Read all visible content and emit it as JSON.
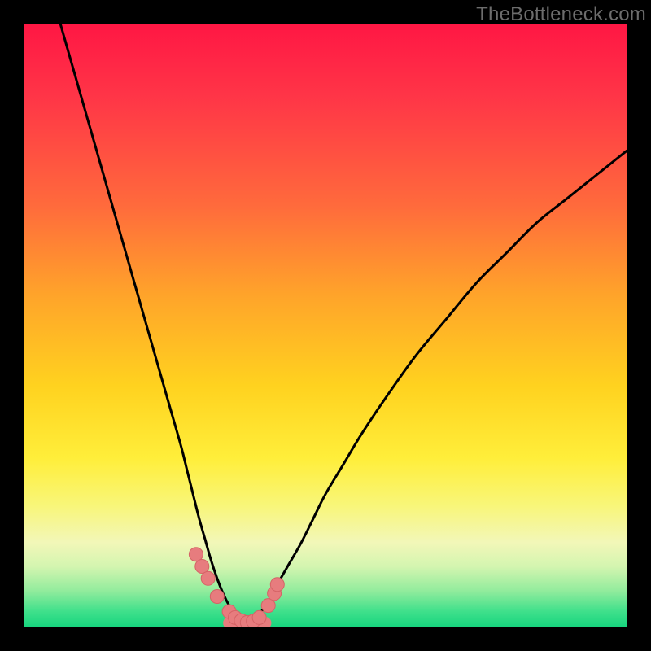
{
  "watermark": "TheBottleneck.com",
  "colors": {
    "black": "#000000",
    "curve": "#000000",
    "marker_fill": "#e77c7e",
    "marker_stroke": "#d56366",
    "gradient_stops": [
      {
        "offset": 0.0,
        "color": "#ff1744"
      },
      {
        "offset": 0.12,
        "color": "#ff3547"
      },
      {
        "offset": 0.3,
        "color": "#ff6a3c"
      },
      {
        "offset": 0.45,
        "color": "#ffa42a"
      },
      {
        "offset": 0.6,
        "color": "#ffd21f"
      },
      {
        "offset": 0.72,
        "color": "#ffee3a"
      },
      {
        "offset": 0.8,
        "color": "#f8f67a"
      },
      {
        "offset": 0.86,
        "color": "#f2f7b8"
      },
      {
        "offset": 0.9,
        "color": "#d4f5b0"
      },
      {
        "offset": 0.94,
        "color": "#93ec9d"
      },
      {
        "offset": 0.975,
        "color": "#3fe08b"
      },
      {
        "offset": 1.0,
        "color": "#18d57f"
      }
    ]
  },
  "chart_data": {
    "type": "line",
    "title": "",
    "xlabel": "",
    "ylabel": "",
    "xlim": [
      0,
      100
    ],
    "ylim": [
      0,
      100
    ],
    "series": [
      {
        "name": "left-curve",
        "x": [
          6,
          8,
          10,
          12,
          14,
          16,
          18,
          20,
          22,
          24,
          26,
          27,
          28,
          29,
          30,
          31,
          32,
          33,
          34,
          35,
          36,
          37
        ],
        "values": [
          100,
          93,
          86,
          79,
          72,
          65,
          58,
          51,
          44,
          37,
          30,
          26,
          22,
          18,
          14.5,
          11,
          8,
          5.5,
          3.5,
          2,
          1,
          0.5
        ]
      },
      {
        "name": "right-curve",
        "x": [
          37,
          38,
          39,
          40,
          41,
          42,
          44,
          46,
          48,
          50,
          53,
          56,
          60,
          65,
          70,
          75,
          80,
          85,
          90,
          95,
          100
        ],
        "values": [
          0.5,
          1,
          2,
          3.5,
          5,
          7,
          10.5,
          14,
          18,
          22,
          27,
          32,
          38,
          45,
          51,
          57,
          62,
          67,
          71,
          75,
          79
        ]
      }
    ],
    "markers": [
      {
        "x": 28.5,
        "y": 12
      },
      {
        "x": 29.5,
        "y": 10
      },
      {
        "x": 30.5,
        "y": 8
      },
      {
        "x": 32,
        "y": 5
      },
      {
        "x": 34,
        "y": 2.5
      },
      {
        "x": 35,
        "y": 1.5
      },
      {
        "x": 36,
        "y": 1
      },
      {
        "x": 37,
        "y": 0.7
      },
      {
        "x": 38,
        "y": 0.9
      },
      {
        "x": 39,
        "y": 1.5
      },
      {
        "x": 40.5,
        "y": 3.5
      },
      {
        "x": 41.5,
        "y": 5.5
      },
      {
        "x": 42,
        "y": 7
      }
    ],
    "trough_band": {
      "x0": 34,
      "x1": 40,
      "y": 0.6
    }
  }
}
